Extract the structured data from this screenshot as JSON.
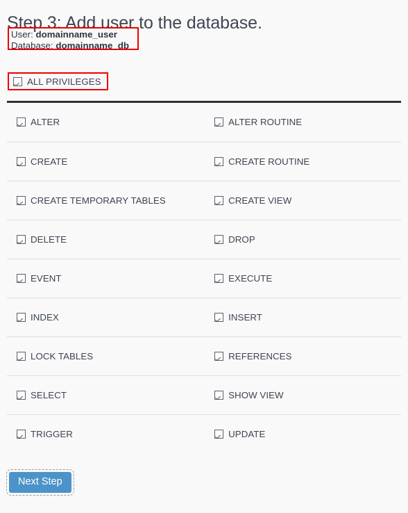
{
  "page": {
    "title": "Step 3: Add user to the database.",
    "background_color": "#f9f9f9",
    "text_color": "#3d4451"
  },
  "info_box": {
    "highlight_color": "#ee0000",
    "user_label": "User:",
    "user_value": "domainname_user",
    "database_label": "Database:",
    "database_value": "domainname_db"
  },
  "all_privileges": {
    "label": "ALL PRIVILEGES",
    "checked": true,
    "highlight_color": "#ee0000",
    "icon": "checkbox-checked-icon"
  },
  "privileges_table": {
    "rule_color": "#2e3138",
    "row_divider_color": "#dededf",
    "rows": [
      {
        "left": "ALTER",
        "right": "ALTER ROUTINE"
      },
      {
        "left": "CREATE",
        "right": "CREATE ROUTINE"
      },
      {
        "left": "CREATE TEMPORARY TABLES",
        "right": "CREATE VIEW"
      },
      {
        "left": "DELETE",
        "right": "DROP"
      },
      {
        "left": "EVENT",
        "right": "EXECUTE"
      },
      {
        "left": "INDEX",
        "right": "INSERT"
      },
      {
        "left": "LOCK TABLES",
        "right": "REFERENCES"
      },
      {
        "left": "SELECT",
        "right": "SHOW VIEW"
      },
      {
        "left": "TRIGGER",
        "right": "UPDATE"
      }
    ]
  },
  "footer": {
    "next_button_label": "Next Step",
    "next_button_color": "#4c93c9"
  }
}
